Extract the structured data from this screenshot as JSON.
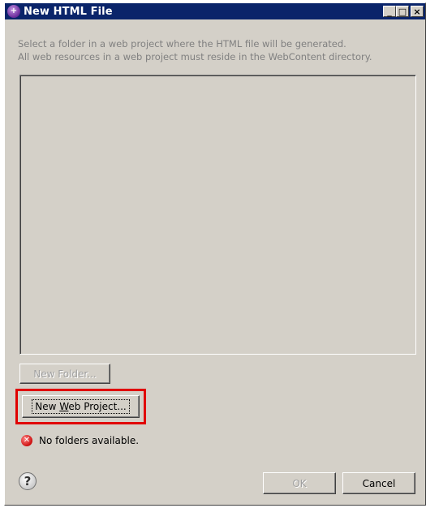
{
  "window": {
    "title": "New HTML File",
    "app_icon": "wizard-icon",
    "controls": {
      "minimize": "_",
      "maximize": "□",
      "close": "×"
    }
  },
  "instructions": {
    "line1": "Select a folder in a web project where the HTML file will be generated.",
    "line2": "All web resources in a web project must reside in the WebContent directory."
  },
  "folder_tree": {
    "items": []
  },
  "buttons": {
    "new_folder": "New Folder...",
    "new_web_project_pre": "New ",
    "new_web_project_mnemonic": "W",
    "new_web_project_post": "eb Project...",
    "ok": "OK",
    "cancel": "Cancel"
  },
  "status": {
    "icon": "error-icon",
    "message": "No folders available."
  },
  "help": {
    "icon": "help-icon"
  },
  "colors": {
    "title_bar": "#0a246a",
    "dialog_bg": "#d4d0c8",
    "highlight": "#e00000",
    "error": "#cc1010"
  }
}
